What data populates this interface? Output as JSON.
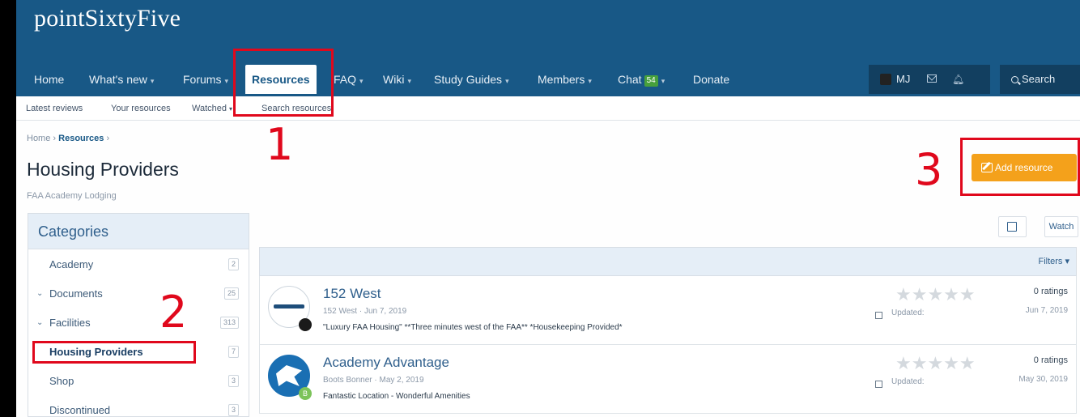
{
  "site": {
    "logo": "pointSixtyFive"
  },
  "nav": {
    "items": [
      {
        "label": "Home",
        "caret": ""
      },
      {
        "label": "What's new",
        "caret": "▾"
      },
      {
        "label": "Forums",
        "caret": "▾"
      },
      {
        "label": "Resources",
        "caret": ""
      },
      {
        "label": "FAQ",
        "caret": "▾"
      },
      {
        "label": "Wiki",
        "caret": "▾"
      },
      {
        "label": "Study Guides",
        "caret": "▾"
      },
      {
        "label": "Members",
        "caret": "▾"
      },
      {
        "label": "Chat",
        "caret": "▾",
        "badge": "54"
      },
      {
        "label": "Donate",
        "caret": ""
      }
    ],
    "user": {
      "name": "MJ"
    },
    "search_label": "Search"
  },
  "subnav": {
    "items": [
      {
        "label": "Latest reviews",
        "caret": ""
      },
      {
        "label": "Your resources",
        "caret": ""
      },
      {
        "label": "Watched",
        "caret": "▾"
      },
      {
        "label": "Search resources",
        "caret": ""
      }
    ]
  },
  "breadcrumb": {
    "home": "Home",
    "sep1": "›",
    "resources": "Resources",
    "sep2": "›"
  },
  "page": {
    "title": "Housing Providers",
    "description": "FAA Academy Lodging",
    "add_button": "Add resource",
    "watch_button": "Watch"
  },
  "categories": {
    "heading": "Categories",
    "items": [
      {
        "label": "Academy",
        "count": "2",
        "chevron": ""
      },
      {
        "label": "Documents",
        "count": "25",
        "chevron": "⌄"
      },
      {
        "label": "Facilities",
        "count": "313",
        "chevron": "⌄"
      },
      {
        "label": "Housing Providers",
        "count": "7",
        "chevron": ""
      },
      {
        "label": "Shop",
        "count": "3",
        "chevron": ""
      },
      {
        "label": "Discontinued",
        "count": "3",
        "chevron": ""
      }
    ]
  },
  "list": {
    "filters_label": "Filters ▾",
    "resources": [
      {
        "title": "152 West",
        "meta": "152 West · Jun 7, 2019",
        "tagline": "\"Luxury FAA Housing\" **Three minutes west of the FAA** *Housekeeping Provided*",
        "stars": "★★★★★",
        "ratings": "0 ratings",
        "updated_label": "Updated:",
        "updated_date": "Jun 7, 2019",
        "badge": "",
        "badge_color": "#1a1a1a"
      },
      {
        "title": "Academy Advantage",
        "meta": "Boots Bonner · May 2, 2019",
        "tagline": "Fantastic Location - Wonderful Amenities",
        "stars": "★★★★★",
        "ratings": "0 ratings",
        "updated_label": "Updated:",
        "updated_date": "May 30, 2019",
        "badge": "B",
        "badge_color": "#7cc35a"
      }
    ]
  },
  "annotations": {
    "one": "1",
    "two": "2",
    "three": "3"
  },
  "colors": {
    "header": "#185886",
    "accent_button": "#f4a11b",
    "annotation": "#e0081c",
    "chat_badge": "#47a03c"
  }
}
